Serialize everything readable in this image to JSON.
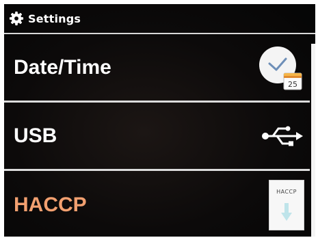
{
  "header": {
    "title": "Settings",
    "icon": "gear-icon"
  },
  "menu": {
    "items": [
      {
        "label": "Date/Time",
        "icon": "clock-calendar-icon",
        "calendar_day": "25",
        "active": false
      },
      {
        "label": "USB",
        "icon": "usb-icon",
        "active": false
      },
      {
        "label": "HACCP",
        "icon": "haccp-download-icon",
        "icon_text": "HACCP",
        "active": true
      }
    ]
  },
  "colors": {
    "background": "#0c0a0a",
    "text": "#ffffff",
    "active_text": "#f2a070",
    "divider": "#dcdcdc"
  }
}
